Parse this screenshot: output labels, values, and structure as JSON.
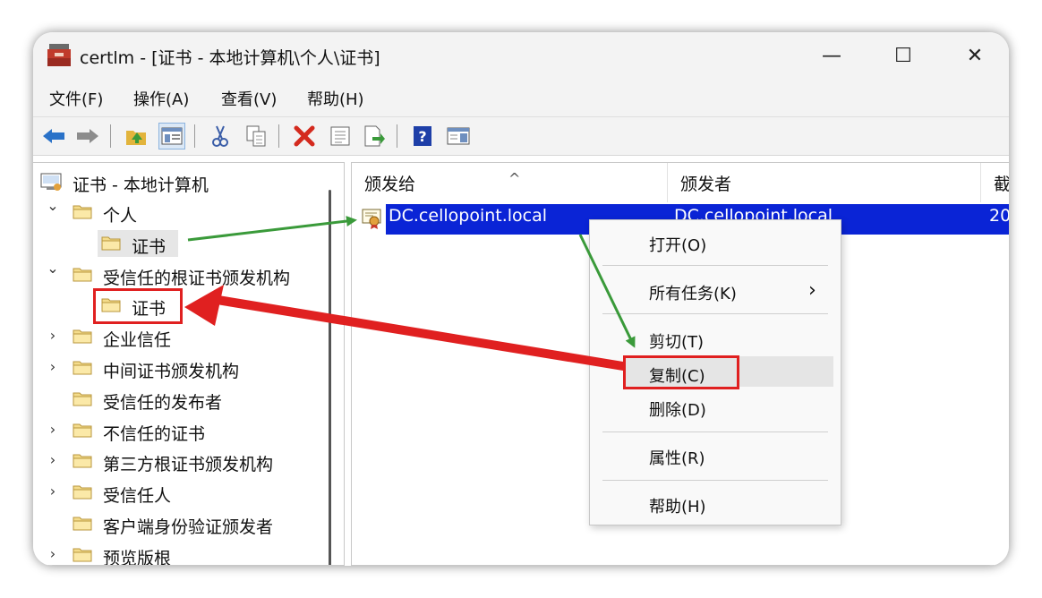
{
  "window": {
    "title": "certlm - [证书 - 本地计算机\\个人\\证书]",
    "minimize_glyph": "—",
    "maximize_glyph": "☐",
    "close_glyph": "✕"
  },
  "menubar": {
    "items": [
      "文件(F)",
      "操作(A)",
      "查看(V)",
      "帮助(H)"
    ]
  },
  "toolbar": {
    "icons": [
      "back-arrow-icon",
      "forward-arrow-icon",
      "up-folder-icon",
      "show-hide-console-tree-icon",
      "cut-icon",
      "copy-icon",
      "delete-icon",
      "properties-icon",
      "export-list-icon",
      "help-icon",
      "action-pane-icon"
    ]
  },
  "tree": {
    "root": "证书 - 本地计算机",
    "items": [
      {
        "label": "个人",
        "expander": "⌄"
      },
      {
        "label": "证书",
        "expander": ""
      },
      {
        "label": "受信任的根证书颁发机构",
        "expander": "⌄"
      },
      {
        "label": "证书",
        "expander": ""
      },
      {
        "label": "企业信任",
        "expander": "›"
      },
      {
        "label": "中间证书颁发机构",
        "expander": "›"
      },
      {
        "label": "受信任的发布者",
        "expander": ""
      },
      {
        "label": "不信任的证书",
        "expander": "›"
      },
      {
        "label": "第三方根证书颁发机构",
        "expander": "›"
      },
      {
        "label": "受信任人",
        "expander": "›"
      },
      {
        "label": "客户端身份验证颁发者",
        "expander": ""
      },
      {
        "label": "预览版根",
        "expander": "›"
      }
    ]
  },
  "list": {
    "sort_indicator": "^",
    "columns": [
      "颁发给",
      "颁发者",
      "截"
    ],
    "rows": [
      {
        "issued_to": "DC.cellopoint.local",
        "issued_by": "DC.cellopoint.local",
        "expires": "20"
      }
    ]
  },
  "context_menu": {
    "items": [
      "打开(O)",
      "所有任务(K)",
      "剪切(T)",
      "复制(C)",
      "删除(D)",
      "属性(R)",
      "帮助(H)"
    ],
    "submenu_arrow": "›"
  },
  "colors": {
    "selection": "#0a24d6",
    "annotation_red": "#e02020",
    "annotation_green": "#3a9a3a"
  }
}
